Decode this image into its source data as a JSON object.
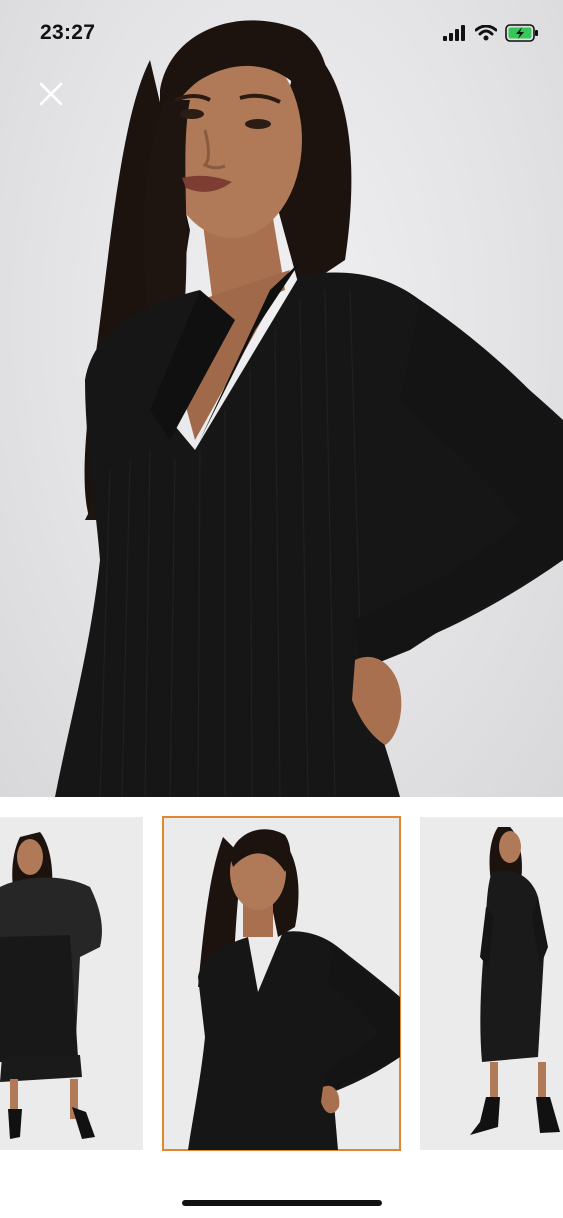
{
  "status_bar": {
    "time": "23:27",
    "icons": [
      "signal-icon",
      "wifi-icon",
      "battery-charging-icon"
    ],
    "battery_color": "#35c759"
  },
  "viewer": {
    "close_icon": "close-icon",
    "main_image": "model-black-ribbed-polo-dress-front",
    "selected_index": 1
  },
  "thumbnails": [
    {
      "name": "model-with-leather-jacket",
      "selected": false
    },
    {
      "name": "model-front-hand-on-hip",
      "selected": true
    },
    {
      "name": "model-back-view",
      "selected": false
    }
  ],
  "colors": {
    "selected_border": "#e0882f",
    "photo_background": "#e6e6e8",
    "garment": "#161616"
  }
}
